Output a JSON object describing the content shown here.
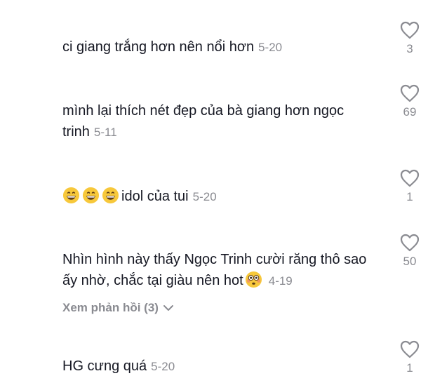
{
  "comments": [
    {
      "text": "ci giang trắng hơn nên nổi hơn",
      "date": "5-20",
      "likes": "3"
    },
    {
      "text": "mình lại thích nét đẹp của bà giang hơn ngọc trinh",
      "date": "5-11",
      "likes": "69"
    },
    {
      "text": "idol của tui",
      "date": "5-20",
      "likes": "1"
    },
    {
      "text": "Nhìn hình này thấy Ngọc Trinh cười răng thô sao ấy nhờ, chắc tại giàu nên hot",
      "date": "4-19",
      "likes": "50",
      "replies_label": "Xem phản hồi (3)"
    },
    {
      "text": "HG cưng quá",
      "date": "5-20",
      "likes": "1"
    }
  ],
  "colors": {
    "text": "#161823",
    "meta": "#8a8b91",
    "emoji_face": "#f7c83b"
  },
  "icons": {
    "like": "heart-outline-icon",
    "grin_emoji": "grinning-face-emoji",
    "flushed_emoji": "flushed-face-emoji",
    "expand": "chevron-down-icon"
  }
}
